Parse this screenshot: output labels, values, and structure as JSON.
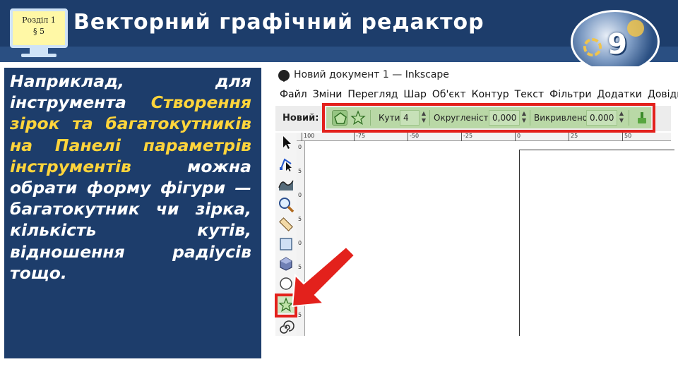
{
  "header": {
    "section_line1": "Розділ 1",
    "section_line2": "§ 5",
    "title": "Векторний графічний редактор",
    "grade_badge": "9"
  },
  "text_panel": {
    "segments": [
      {
        "text": "Наприклад, для інструмента ",
        "highlight": false
      },
      {
        "text": "Створення зірок та багатокутників на Панелі параметрів інструментів",
        "highlight": true
      },
      {
        "text": " можна обрати форму фігури — багатокутник чи зірка, кількість кутів, відношення радіусів тощо.",
        "highlight": false
      }
    ],
    "colors": {
      "background": "#1d3d6b",
      "text": "#ffffff",
      "highlight": "#ffd43b"
    }
  },
  "inkscape": {
    "window_title": "Новий документ 1 — Inkscape",
    "menu": [
      "Файл",
      "Зміни",
      "Перегляд",
      "Шар",
      "Об'єкт",
      "Контур",
      "Текст",
      "Фільтри",
      "Додатки",
      "Довідка"
    ],
    "controls": {
      "new_label": "Новий:",
      "corners_label": "Кути:",
      "corners_value": "4",
      "roundness_label": "Округленість:",
      "roundness_value": "0,000",
      "randomize_label": "Викривлено:",
      "randomize_value": "0.000"
    },
    "ruler_top": [
      "100",
      "-75",
      "-50",
      "-25",
      "0",
      "25",
      "50"
    ],
    "ruler_left": [
      "0",
      "5",
      "0",
      "5",
      "0",
      "5",
      "0",
      "5"
    ],
    "tools": [
      "selector-tool",
      "node-tool",
      "tweak-tool",
      "zoom-tool",
      "measure-tool",
      "rectangle-tool",
      "box3d-tool",
      "ellipse-tool",
      "star-tool",
      "spiral-tool"
    ],
    "highlight_color": "#e3211c",
    "panel_green": "#b9d8a6"
  }
}
